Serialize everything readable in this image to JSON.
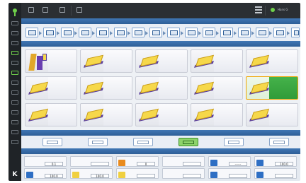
{
  "top_bar": {
    "buttons": [
      {
        "icon": "home-icon",
        "label": ""
      },
      {
        "icon": "folder-icon",
        "label": ""
      },
      {
        "icon": "wrench-icon",
        "label": ""
      },
      {
        "icon": "gauge-icon",
        "label": ""
      }
    ],
    "user": "Hans G"
  },
  "sections": {
    "process": "",
    "products": "",
    "tools": "",
    "parameters": ""
  },
  "tiles": [
    {
      "title": "",
      "sub": "",
      "image": "special-profile-icon"
    },
    {
      "title": "",
      "sub": "",
      "image": "panel-icon"
    },
    {
      "title": "",
      "sub": "",
      "image": "panel-icon"
    },
    {
      "title": "",
      "sub": "",
      "image": "panel-icon"
    },
    {
      "title": "",
      "sub": "",
      "image": "panel-icon"
    },
    {
      "title": "",
      "sub": "",
      "image": "panel-icon"
    },
    {
      "title": "",
      "sub": "",
      "image": "panel-icon"
    },
    {
      "title": "",
      "sub": "",
      "image": "panel-icon"
    },
    {
      "title": "",
      "sub": "",
      "image": "panel-icon"
    },
    {
      "title": "",
      "sub": "",
      "image": "panel-icon",
      "selected": true
    },
    {
      "title": "",
      "sub": "",
      "image": "panel-icon"
    },
    {
      "title": "",
      "sub": "",
      "image": "panel-icon"
    },
    {
      "title": "",
      "sub": "",
      "image": "panel-icon"
    },
    {
      "title": "",
      "sub": "",
      "image": "panel-icon"
    },
    {
      "title": "",
      "sub": "",
      "image": "panel-icon"
    }
  ],
  "params": [
    {
      "label": "",
      "value": "0.1"
    },
    {
      "label": "",
      "value": ""
    },
    {
      "label": "",
      "value": "0"
    },
    {
      "label": "",
      "value": ""
    },
    {
      "label": "",
      "value": "------"
    },
    {
      "label": "",
      "value": "100.0"
    },
    {
      "label": "",
      "value": "100.0"
    },
    {
      "label": "",
      "value": "100.0"
    },
    {
      "label": "",
      "value": ""
    },
    {
      "label": "",
      "value": ""
    },
    {
      "label": "",
      "value": ""
    },
    {
      "label": "",
      "value": ""
    }
  ],
  "brand": "K",
  "colors": {
    "accent": "#2e5e97",
    "active_tab": "#8ed36a",
    "selected_border": "#f0a400",
    "selected_fill": "#2f9a38"
  }
}
